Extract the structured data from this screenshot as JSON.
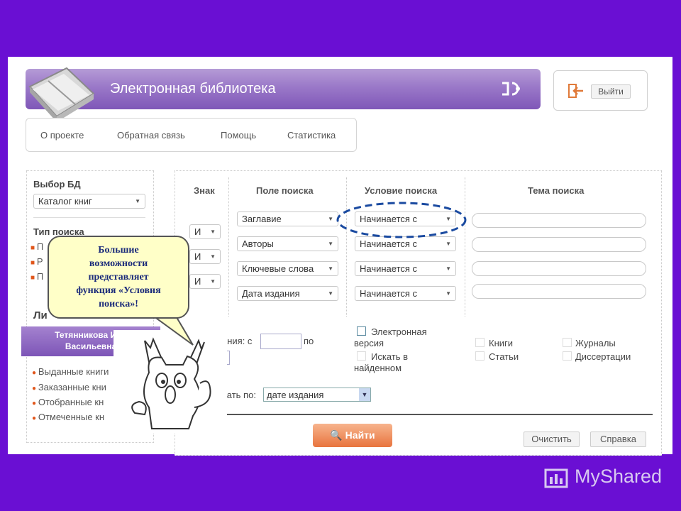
{
  "header": {
    "title": "Электронная библиотека",
    "logout_label": "Выйти"
  },
  "nav": {
    "items": [
      "О проекте",
      "Обратная связь",
      "Помощь",
      "Статистика"
    ]
  },
  "sidebar": {
    "db_heading": "Выбор БД",
    "db_value": "Каталог книг",
    "search_type_heading": "Тип поиска",
    "search_type_items": [
      "П",
      "Р",
      "П"
    ],
    "personal_heading": "Ли",
    "user_name_line1": "Тетянникова Ири",
    "user_name_line2": "Васильевна",
    "links": [
      "Выданные книги",
      "Заказанные кни",
      "Отобранные кн",
      "Отмеченные кн"
    ]
  },
  "columns": {
    "sign": "Знак",
    "field": "Поле поиска",
    "condition": "Условие поиска",
    "topic": "Тема поиска"
  },
  "rows": [
    {
      "sign": "",
      "field": "Заглавие",
      "condition": "Начинается с"
    },
    {
      "sign": "И",
      "field": "Авторы",
      "condition": "Начинается с"
    },
    {
      "sign": "И",
      "field": "Ключевые слова",
      "condition": "Начинается с"
    },
    {
      "sign": "И",
      "field": "Дата издания",
      "condition": "Начинается с"
    }
  ],
  "options": {
    "year_from_label": "ания: с",
    "year_to_label": "по",
    "electronic_line1": "Электронная",
    "electronic_line2": "версия",
    "in_found_line1": "Искать в",
    "in_found_line2": "найденном",
    "books": "Книги",
    "journals": "Журналы",
    "articles": "Статьи",
    "dissertations": "Диссертации",
    "sort_label": "вать по:",
    "sort_value": "дате издания"
  },
  "buttons": {
    "find": "Найти",
    "clear": "Очистить",
    "help": "Справка"
  },
  "callout": {
    "line1": "Большие",
    "line2": "возможности",
    "line3": "представляет",
    "line4": "функция «Условия",
    "line5": "поиска»!"
  },
  "watermark": "MyShared",
  "colors": {
    "background": "#6a0fd3",
    "header_purple": "#9a78c8",
    "accent_orange": "#e8743e",
    "highlight_blue": "#1a4aa0"
  }
}
